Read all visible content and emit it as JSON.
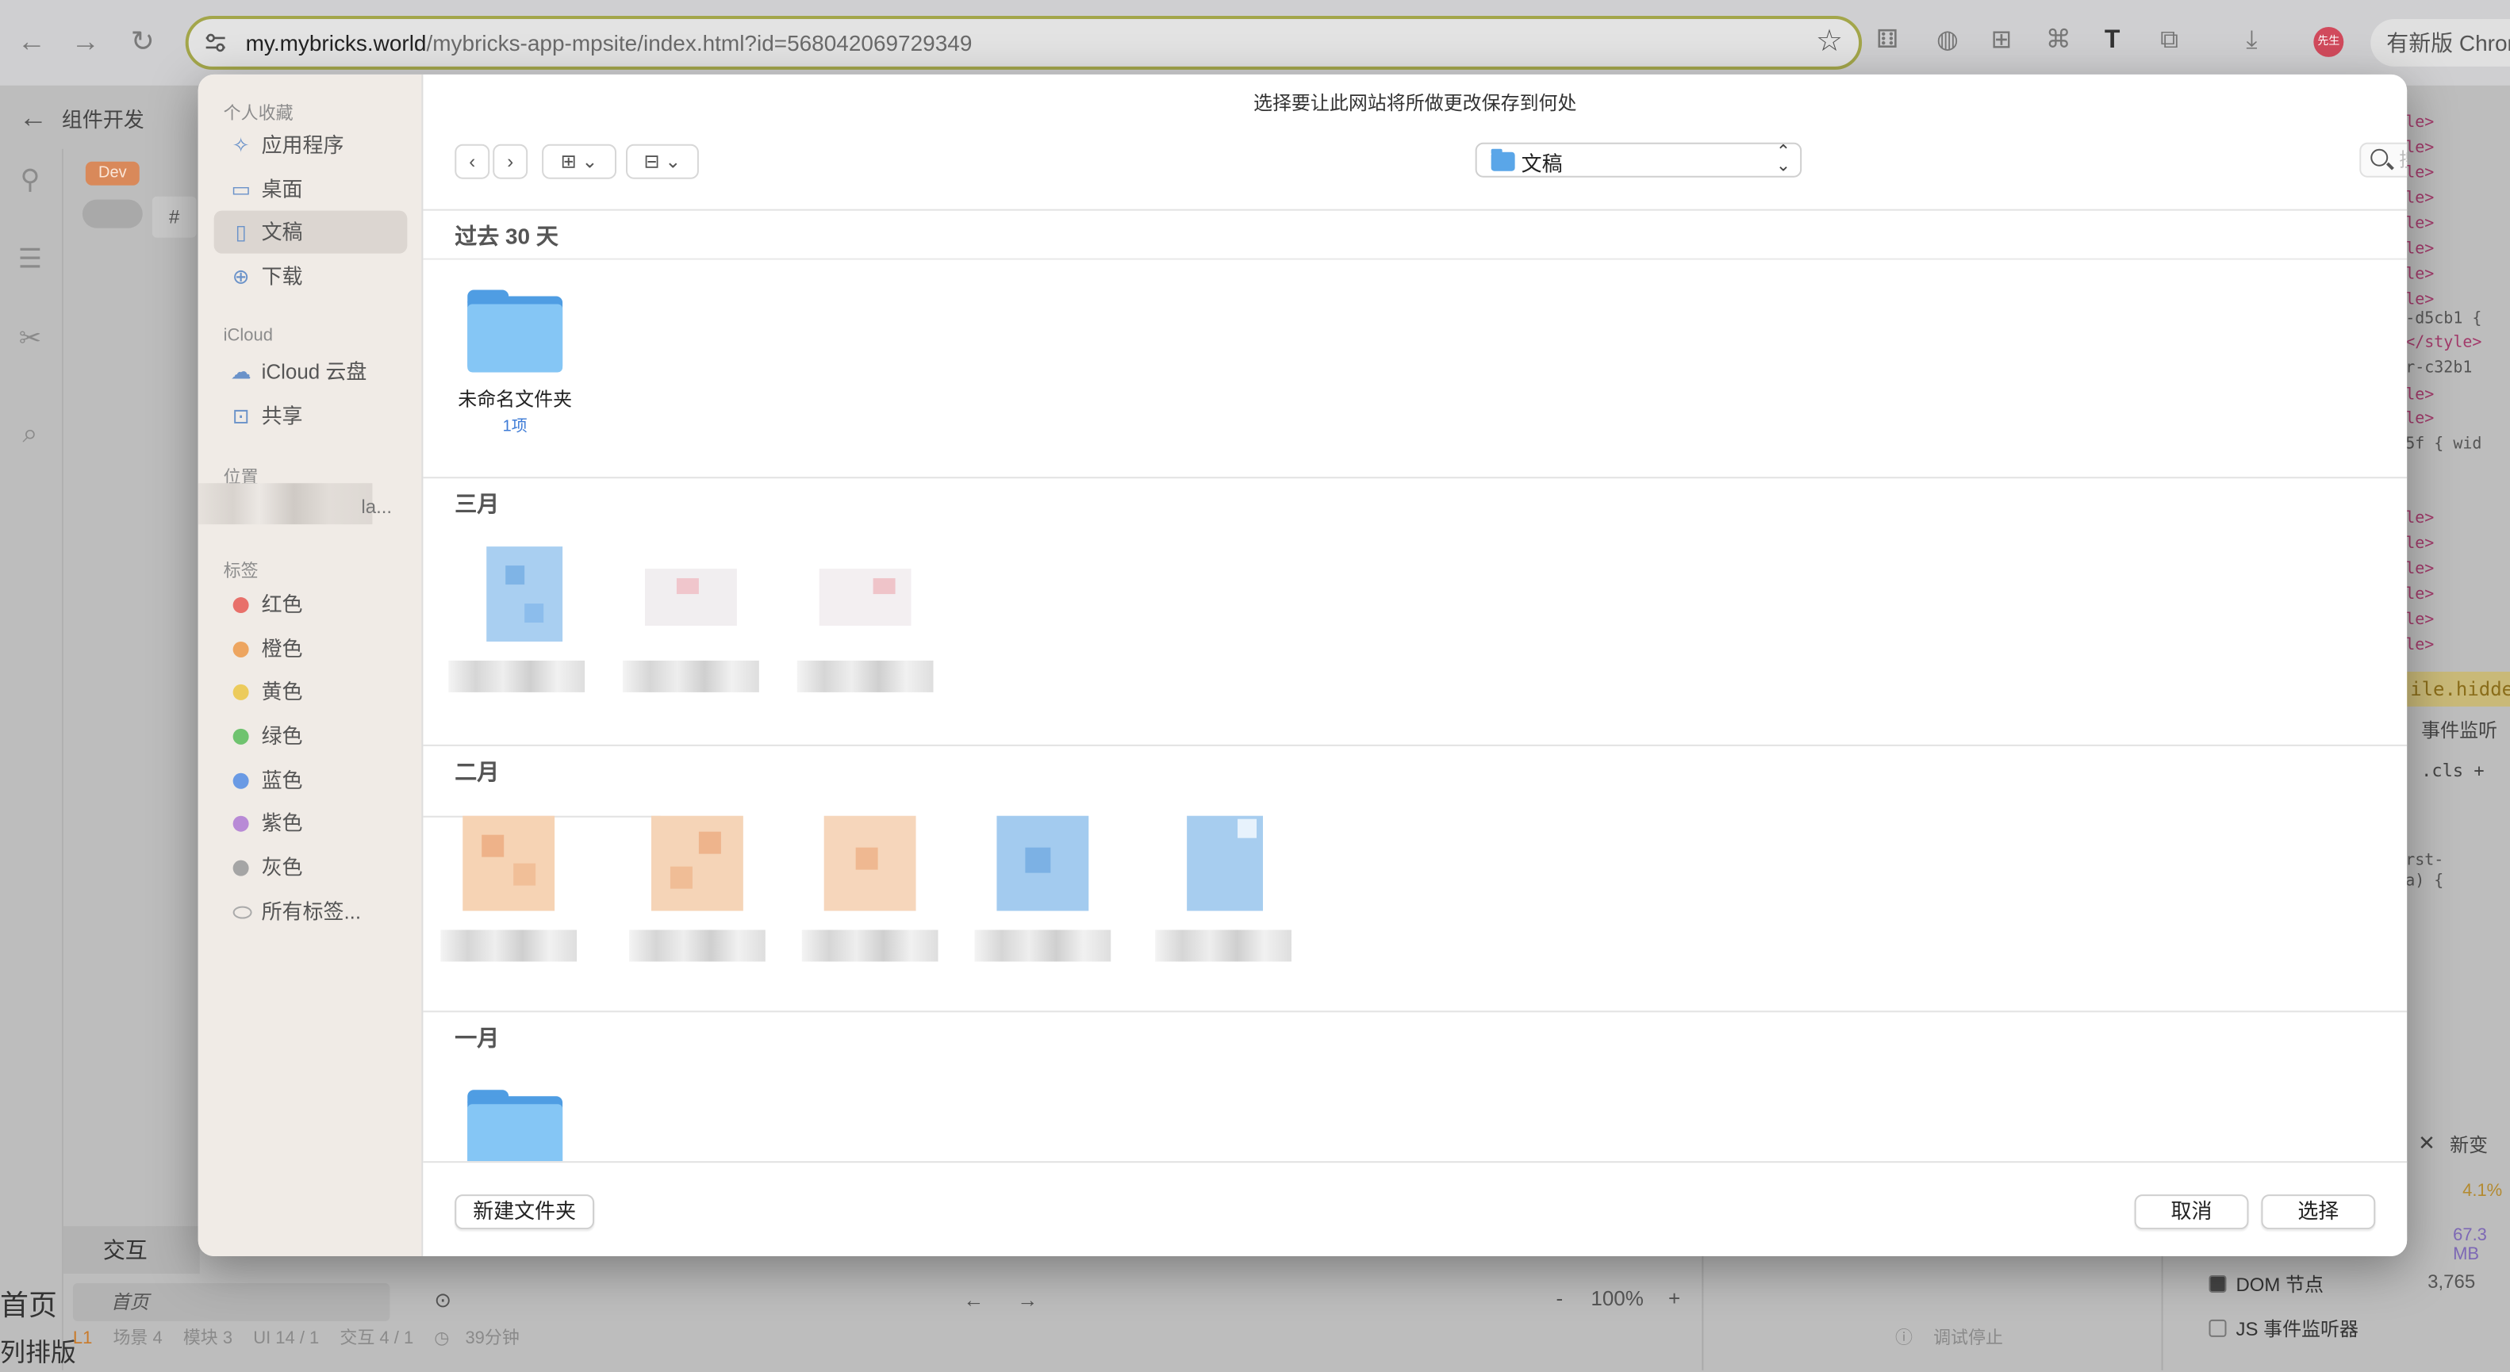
{
  "browser": {
    "url_host": "my.mybricks.world",
    "url_path": "/mybricks-app-mpsite/index.html?id=568042069729349",
    "avatar_text": "先生",
    "update_label": "有新版 Chrome"
  },
  "background_app": {
    "title": "组件开发",
    "dev_badge": "Dev",
    "hash_label": "#",
    "interaction_label": "交互",
    "page_item": "首页",
    "home_label": "首页",
    "layout_label": "列排版",
    "status": [
      "L1",
      "场景 4",
      "模块 3",
      "UI 14 / 1",
      "交互 4 / 1",
      "39分钟"
    ],
    "zoom_minus": "-",
    "zoom_value": "100%",
    "zoom_plus": "+",
    "debug_stopped": "调试停止",
    "devtools": {
      "code_lines": [
        "le>",
        "le>",
        "le>",
        "le>",
        "le>",
        "le>",
        "le>",
        "le>",
        "-d5cb1 {",
        "</style>",
        "r-c32b1",
        "le>",
        "le>",
        "5f { wid",
        "le>",
        "le>",
        "le>",
        "le>",
        "le>",
        "le>"
      ],
      "hidden_text": "ile.hidde",
      "events_tab": "事件监听",
      "cls": ".cls  +",
      "css_a": "rst-",
      "css_b": "a) {",
      "close": "✕",
      "new_label": "新变",
      "cpu_pct": "4.1%",
      "heap": "67.3 MB",
      "dom_nodes_label": "DOM 节点",
      "dom_nodes_value": "3,765",
      "js_listeners_label": "JS 事件监听器"
    }
  },
  "dialog": {
    "title": "选择要让此网站将所做更改保存到何处",
    "sidebar": {
      "favorites_header": "个人收藏",
      "favorites": [
        {
          "label": "应用程序",
          "icon": "apps-icon"
        },
        {
          "label": "桌面",
          "icon": "desktop-icon"
        },
        {
          "label": "文稿",
          "icon": "document-icon",
          "selected": true
        },
        {
          "label": "下载",
          "icon": "download-icon"
        }
      ],
      "icloud_header": "iCloud",
      "icloud": [
        {
          "label": "iCloud 云盘",
          "icon": "cloud-icon"
        },
        {
          "label": "共享",
          "icon": "shared-folder-icon"
        }
      ],
      "locations_header": "位置",
      "location_suffix": "la...",
      "tags_header": "标签",
      "tags": [
        {
          "label": "红色",
          "color": "#e8706a"
        },
        {
          "label": "橙色",
          "color": "#eda560"
        },
        {
          "label": "黄色",
          "color": "#eccb5c"
        },
        {
          "label": "绿色",
          "color": "#6fc36f"
        },
        {
          "label": "蓝色",
          "color": "#6a9ae4"
        },
        {
          "label": "紫色",
          "color": "#b88ad6"
        },
        {
          "label": "灰色",
          "color": "#a5a5a5"
        },
        {
          "label": "所有标签...",
          "color": ""
        }
      ]
    },
    "toolbar": {
      "back": "‹",
      "forward": "›",
      "view_icon": "⊞",
      "group_icon": "⊟",
      "location": "文稿",
      "search_placeholder": "搜索"
    },
    "groups": [
      {
        "label": "过去 30 天"
      },
      {
        "label": "三月"
      },
      {
        "label": "二月"
      },
      {
        "label": "一月"
      }
    ],
    "folder_item": {
      "name": "未命名文件夹",
      "sub": "1项"
    },
    "new_folder_label": "新建文件夹",
    "cancel_label": "取消",
    "choose_label": "选择"
  }
}
